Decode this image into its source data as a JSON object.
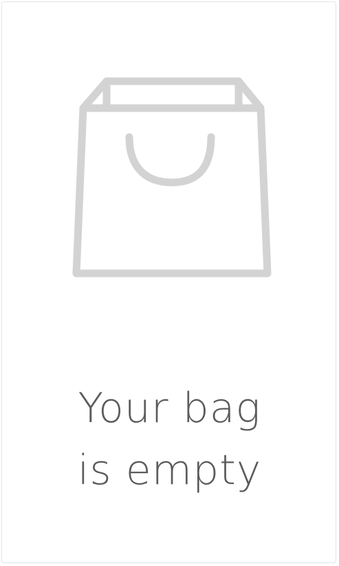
{
  "empty_state": {
    "line1": "Your bag",
    "line2": "is empty",
    "icon": "shopping-bag-icon",
    "icon_color": "#d3d3d3",
    "text_color": "#5b5b5b"
  }
}
